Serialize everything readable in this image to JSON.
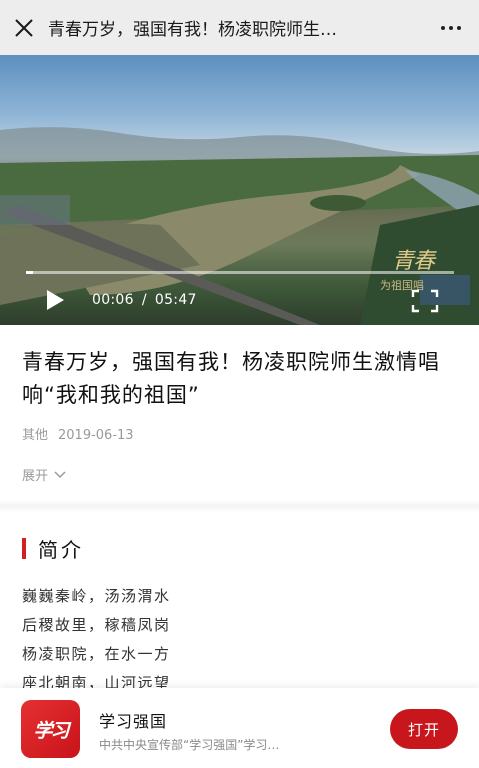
{
  "nav": {
    "title": "青春万岁，强国有我！杨凌职院师生…",
    "close_icon": "close-icon",
    "more_icon": "more-icon"
  },
  "video": {
    "current_time": "00:06",
    "separator": "/",
    "duration": "05:47",
    "progress": 0.017,
    "watermark": "青春",
    "watermark_sub": "为祖国唱",
    "play_icon": "play-icon",
    "fullscreen_icon": "fullscreen-icon"
  },
  "article": {
    "title": "青春万岁，强国有我！杨凌职院师生激情唱响“我和我的祖国”",
    "category": "其他",
    "date": "2019-06-13",
    "expand_label": "展开"
  },
  "intro": {
    "heading": "简介",
    "lines": [
      "巍巍秦岭，汤汤渭水",
      "后稷故里，稼穑凤岗",
      "杨凌职院，在水一方",
      "座北朝南，山河远望"
    ]
  },
  "app_banner": {
    "logo_text": "学习",
    "name": "学习强国",
    "description": "中共中央宣传部“学习强国”学习…",
    "open_label": "打开",
    "accent": "#c8161d"
  }
}
